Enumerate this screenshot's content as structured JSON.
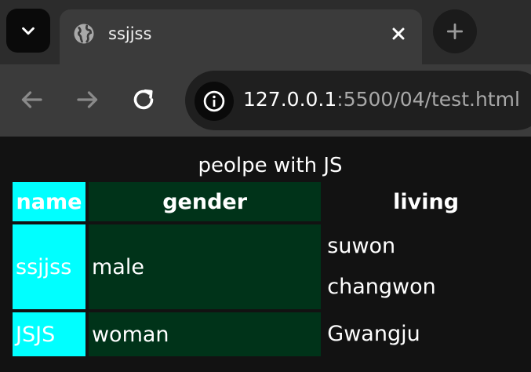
{
  "colors": {
    "name_column": "#00ffff",
    "gender_column": "#003319",
    "page_background": "#121212",
    "toolbar": "#3b3b3b",
    "tabstrip": "#2c2c2c"
  },
  "browser": {
    "tab": {
      "title": "ssjjss",
      "icon": "globe-icon"
    },
    "url": {
      "host": "127.0.0.1",
      "rest": ":5500/04/test.html"
    }
  },
  "table": {
    "caption": "peolpe with JS",
    "headers": [
      "name",
      "gender",
      "living"
    ],
    "rows": [
      {
        "name": "ssjjss",
        "gender": "male",
        "living": [
          "suwon",
          "changwon"
        ]
      },
      {
        "name": "JSJS",
        "gender": "woman",
        "living": [
          "Gwangju"
        ]
      }
    ]
  }
}
